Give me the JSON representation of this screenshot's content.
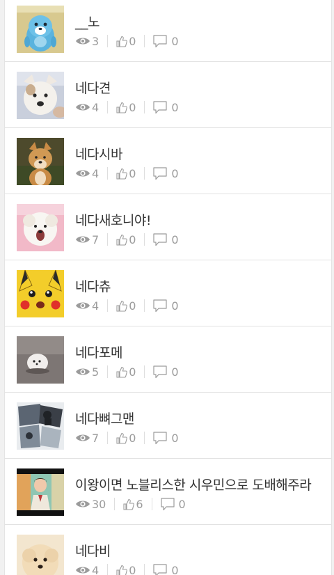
{
  "posts": [
    {
      "title": "__노",
      "views": "3",
      "likes": "0",
      "comments": "0",
      "thumb": "cartoon-seal"
    },
    {
      "title": "네다견",
      "views": "4",
      "likes": "0",
      "comments": "0",
      "thumb": "white-puppy"
    },
    {
      "title": "네다시바",
      "views": "4",
      "likes": "0",
      "comments": "0",
      "thumb": "shiba-dog"
    },
    {
      "title": "네다새호니야!",
      "views": "7",
      "likes": "0",
      "comments": "0",
      "thumb": "yawning-dog"
    },
    {
      "title": "네다츄",
      "views": "4",
      "likes": "0",
      "comments": "0",
      "thumb": "pikachu"
    },
    {
      "title": "네다포메",
      "views": "5",
      "likes": "0",
      "comments": "0",
      "thumb": "pomeranian"
    },
    {
      "title": "네다뼈그맨",
      "views": "7",
      "likes": "0",
      "comments": "0",
      "thumb": "photo-collage"
    },
    {
      "title": "이왕이면 노블리스한 시우민으로 도배해주라",
      "views": "30",
      "likes": "6",
      "comments": "0",
      "thumb": "man-video-still"
    },
    {
      "title": "네다비",
      "views": "4",
      "likes": "0",
      "comments": "0",
      "thumb": "fluffy-dog"
    }
  ],
  "icons": {
    "views": "eye-icon",
    "likes": "thumbs-up-icon",
    "comments": "comment-icon"
  },
  "colors": {
    "meta_text": "#9b9b9b",
    "title_text": "#333333",
    "divider": "#e2e2e2"
  }
}
